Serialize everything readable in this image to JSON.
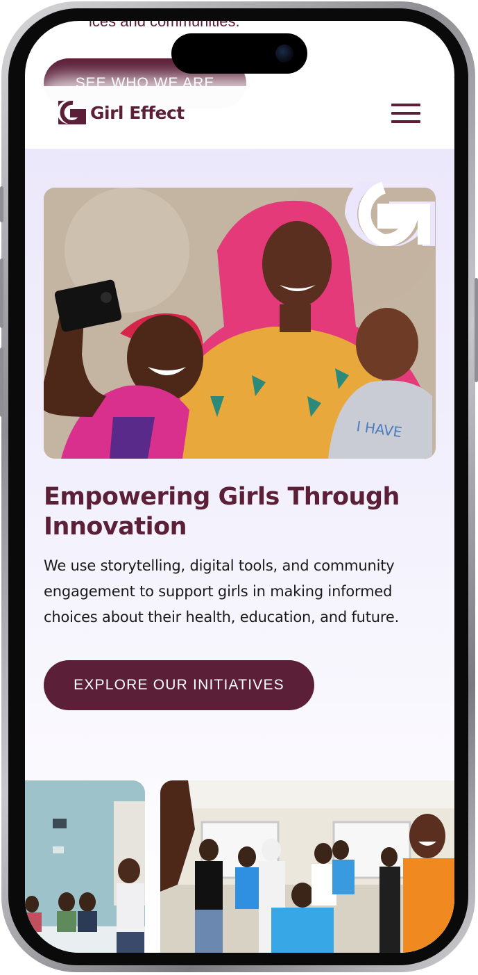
{
  "header": {
    "brand_name": "Girl Effect",
    "menu_icon": "hamburger-menu-icon"
  },
  "previous_section": {
    "partial_text": "ices and communities.",
    "button_label": "SEE WHO WE ARE"
  },
  "hero": {
    "image_description_icon": "photo-girls-selfie",
    "decor_icon": "brand-g-mark-icon",
    "title": "Empowering Girls Through Innovation",
    "description": "We use storytelling, digital tools, and community engagement to support girls in making informed choices about their health, education, and future.",
    "cta_label": "EXPLORE OUR INITIATIVES"
  },
  "gallery": {
    "items": [
      {
        "icon": "photo-workshop-meeting"
      },
      {
        "icon": "photo-group-celebration"
      }
    ]
  },
  "colors": {
    "brand": "#5c1f38",
    "hero_bg": "#ece8fb",
    "text": "#1a1a1a"
  }
}
